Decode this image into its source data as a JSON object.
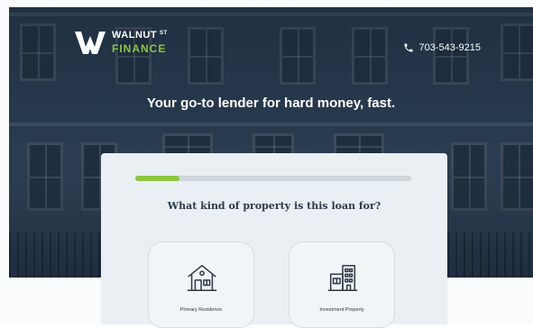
{
  "brand": {
    "name_top": "WALNUT",
    "name_sup": "ST",
    "name_bottom": "FINANCE",
    "accent_color": "#8cc63f"
  },
  "header": {
    "phone": "703-543-9215",
    "phone_icon": "phone-icon"
  },
  "hero": {
    "title": "Your go-to lender for hard money, fast."
  },
  "form": {
    "progress_fraction": 0.16,
    "question": "What kind of property is this loan for?",
    "options": [
      {
        "label": "Primary Residence",
        "icon": "house-icon"
      },
      {
        "label": "Investment Property",
        "icon": "buildings-icon"
      }
    ]
  }
}
